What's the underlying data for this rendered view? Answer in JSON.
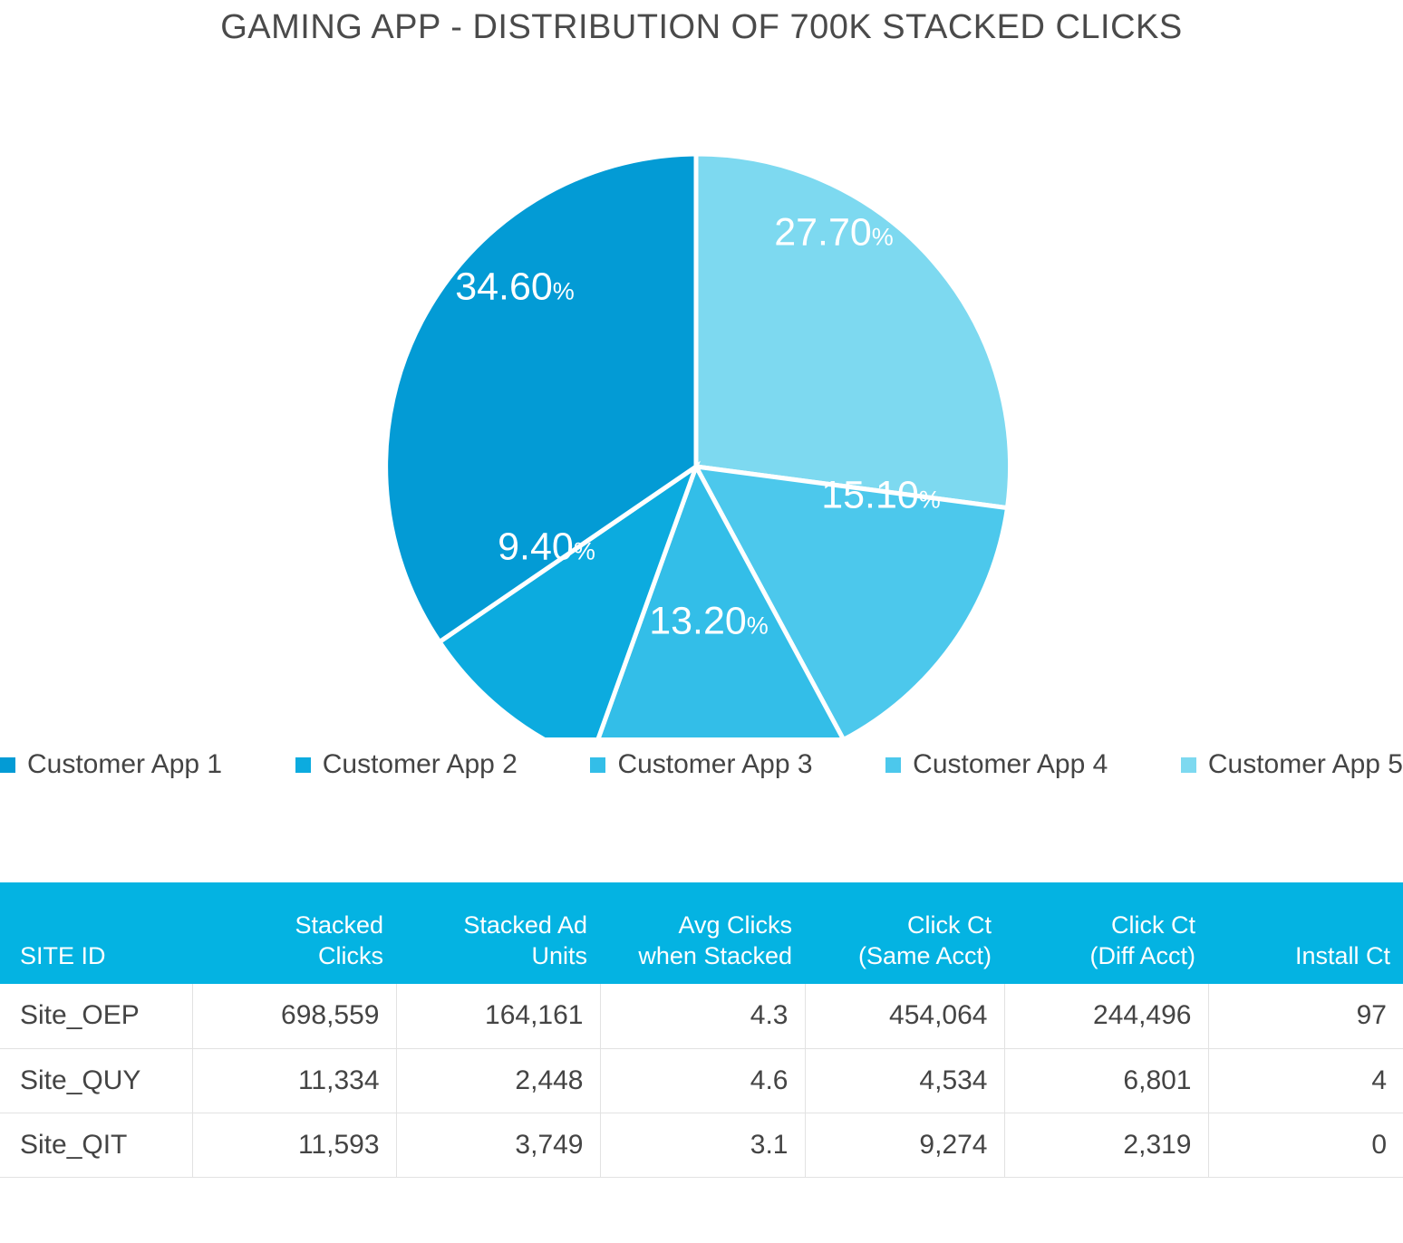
{
  "title": "GAMING APP - DISTRIBUTION OF 700K STACKED CLICKS",
  "colors": {
    "app1": "#039BD5",
    "app2": "#0CABDF",
    "app3": "#33BEE8",
    "app4": "#4CC8EC",
    "app5": "#7DD9F0",
    "table_header_bg": "#04B3E2",
    "text": "#444444",
    "slice_border": "#FFFFFF"
  },
  "chart_data": {
    "type": "pie",
    "title": "GAMING APP - DISTRIBUTION OF 700K STACKED CLICKS",
    "categories": [
      "Customer App 1",
      "Customer App 2",
      "Customer App 3",
      "Customer App 4",
      "Customer App 5"
    ],
    "values": [
      34.6,
      9.4,
      13.2,
      15.1,
      27.7
    ],
    "value_labels": [
      "34.60%",
      "9.40%",
      "13.20%",
      "15.10%",
      "27.70%"
    ],
    "colors": [
      "#039BD5",
      "#0CABDF",
      "#33BEE8",
      "#4CC8EC",
      "#7DD9F0"
    ],
    "unit": "%",
    "legend_position": "bottom",
    "start_angle_deg": 0,
    "direction": "clockwise",
    "slices": [
      {
        "label": "Customer App 5",
        "value": 27.7,
        "display": "27.70%",
        "color": "#7DD9F0"
      },
      {
        "label": "Customer App 4",
        "value": 15.1,
        "display": "15.10%",
        "color": "#4CC8EC"
      },
      {
        "label": "Customer App 3",
        "value": 13.2,
        "display": "13.20%",
        "color": "#33BEE8"
      },
      {
        "label": "Customer App 2",
        "value": 9.4,
        "display": "9.40%",
        "color": "#0CABDF"
      },
      {
        "label": "Customer App 1",
        "value": 34.6,
        "display": "34.60%",
        "color": "#039BD5"
      }
    ]
  },
  "pie_labels": {
    "s27": {
      "num": "27.70",
      "pct": "%"
    },
    "s15": {
      "num": "15.10",
      "pct": "%"
    },
    "s13": {
      "num": "13.20",
      "pct": "%"
    },
    "s9": {
      "num": "9.40",
      "pct": "%"
    },
    "s34": {
      "num": "34.60",
      "pct": "%"
    }
  },
  "legend": {
    "items": [
      {
        "label": "Customer App 1",
        "color": "#039BD5"
      },
      {
        "label": "Customer App 2",
        "color": "#0CABDF"
      },
      {
        "label": "Customer App 3",
        "color": "#33BEE8"
      },
      {
        "label": "Customer App 4",
        "color": "#4CC8EC"
      },
      {
        "label": "Customer App 5",
        "color": "#7DD9F0"
      }
    ]
  },
  "table": {
    "headers": [
      {
        "line1": "",
        "line2": "SITE ID"
      },
      {
        "line1": "Stacked",
        "line2": "Clicks"
      },
      {
        "line1": "Stacked Ad",
        "line2": "Units"
      },
      {
        "line1": "Avg Clicks",
        "line2": "when Stacked"
      },
      {
        "line1": "Click Ct",
        "line2": "(Same Acct)"
      },
      {
        "line1": "Click Ct",
        "line2": "(Diff Acct)"
      },
      {
        "line1": "",
        "line2": "Install Ct"
      }
    ],
    "rows": [
      {
        "site_id": "Site_OEP",
        "stacked_clicks": "698,559",
        "stacked_ad_units": "164,161",
        "avg_clicks_when_stacked": "4.3",
        "click_ct_same_acct": "454,064",
        "click_ct_diff_acct": "244,496",
        "install_ct": "97"
      },
      {
        "site_id": "Site_QUY",
        "stacked_clicks": "11,334",
        "stacked_ad_units": "2,448",
        "avg_clicks_when_stacked": "4.6",
        "click_ct_same_acct": "4,534",
        "click_ct_diff_acct": "6,801",
        "install_ct": "4"
      },
      {
        "site_id": "Site_QIT",
        "stacked_clicks": "11,593",
        "stacked_ad_units": "3,749",
        "avg_clicks_when_stacked": "3.1",
        "click_ct_same_acct": "9,274",
        "click_ct_diff_acct": "2,319",
        "install_ct": "0"
      }
    ]
  }
}
